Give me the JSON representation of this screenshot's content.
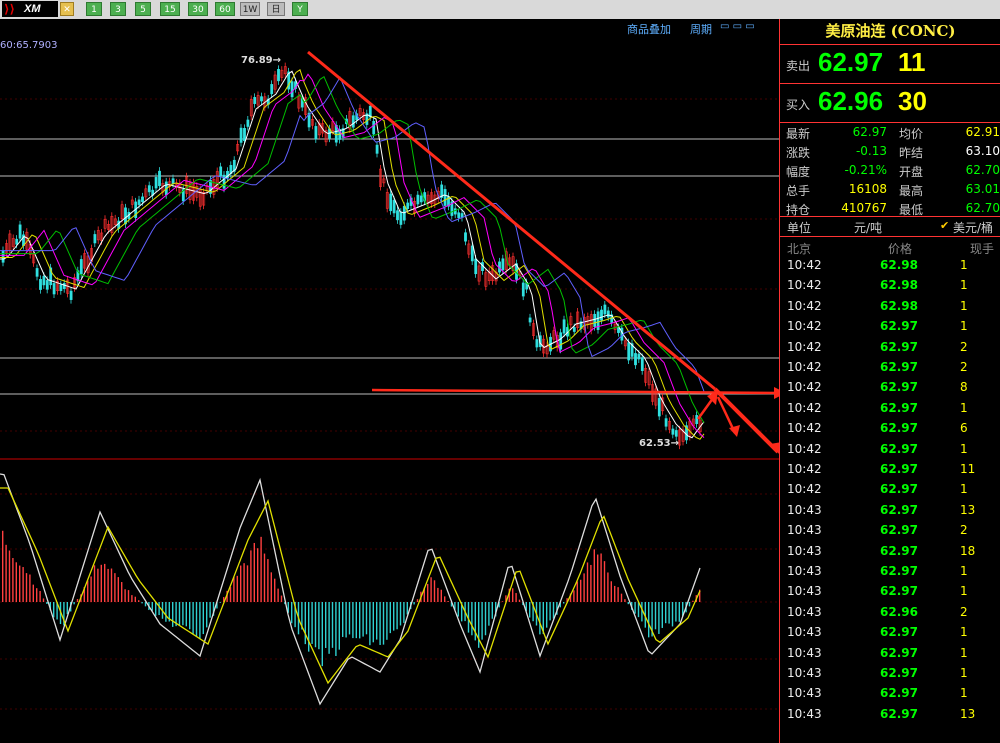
{
  "toolbar": {
    "logo_text": "XM",
    "buttons": [
      "1",
      "3",
      "5",
      "15",
      "30",
      "60",
      "1W",
      "日",
      "Y"
    ]
  },
  "chart": {
    "ma_text": "60:65.7903",
    "menu_overlay": "商品叠加",
    "menu_period": "周期",
    "label_high": "76.89→",
    "label_low": "62.53→"
  },
  "panel": {
    "title": "美原油连 (CONC)",
    "sell_label": "卖出",
    "sell_price": "62.97",
    "sell_vol": "11",
    "buy_label": "买入",
    "buy_price": "62.96",
    "buy_vol": "30",
    "stats_left": [
      {
        "label": "最新",
        "value": "62.97",
        "color": "#00ff00"
      },
      {
        "label": "涨跌",
        "value": "-0.13",
        "color": "#00ff00"
      },
      {
        "label": "幅度",
        "value": "-0.21%",
        "color": "#00ff00"
      },
      {
        "label": "总手",
        "value": "16108",
        "color": "#ffff00"
      },
      {
        "label": "持仓",
        "value": "410767",
        "color": "#ffff00"
      }
    ],
    "stats_right": [
      {
        "label": "均价",
        "value": "62.91",
        "color": "#ffff00"
      },
      {
        "label": "昨结",
        "value": "63.10",
        "color": "#ffffff"
      },
      {
        "label": "开盘",
        "value": "62.70",
        "color": "#00ff00"
      },
      {
        "label": "最高",
        "value": "63.01",
        "color": "#00ff00"
      },
      {
        "label": "最低",
        "value": "62.70",
        "color": "#00ff00"
      }
    ],
    "unit_label": "单位",
    "unit_a": "元/吨",
    "unit_b": "美元/桶",
    "head_time": "北京",
    "head_price": "价格",
    "head_vol": "现手",
    "ticks": [
      {
        "t": "10:42",
        "p": "62.98",
        "v": "1"
      },
      {
        "t": "10:42",
        "p": "62.98",
        "v": "1"
      },
      {
        "t": "10:42",
        "p": "62.98",
        "v": "1"
      },
      {
        "t": "10:42",
        "p": "62.97",
        "v": "1"
      },
      {
        "t": "10:42",
        "p": "62.97",
        "v": "2"
      },
      {
        "t": "10:42",
        "p": "62.97",
        "v": "2"
      },
      {
        "t": "10:42",
        "p": "62.97",
        "v": "8"
      },
      {
        "t": "10:42",
        "p": "62.97",
        "v": "1"
      },
      {
        "t": "10:42",
        "p": "62.97",
        "v": "6"
      },
      {
        "t": "10:42",
        "p": "62.97",
        "v": "1"
      },
      {
        "t": "10:42",
        "p": "62.97",
        "v": "11"
      },
      {
        "t": "10:42",
        "p": "62.97",
        "v": "1"
      },
      {
        "t": "10:43",
        "p": "62.97",
        "v": "13"
      },
      {
        "t": "10:43",
        "p": "62.97",
        "v": "2"
      },
      {
        "t": "10:43",
        "p": "62.97",
        "v": "18"
      },
      {
        "t": "10:43",
        "p": "62.97",
        "v": "1"
      },
      {
        "t": "10:43",
        "p": "62.97",
        "v": "1"
      },
      {
        "t": "10:43",
        "p": "62.96",
        "v": "2"
      },
      {
        "t": "10:43",
        "p": "62.97",
        "v": "1"
      },
      {
        "t": "10:43",
        "p": "62.97",
        "v": "1"
      },
      {
        "t": "10:43",
        "p": "62.97",
        "v": "1"
      },
      {
        "t": "10:43",
        "p": "62.97",
        "v": "1"
      },
      {
        "t": "10:43",
        "p": "62.97",
        "v": "13"
      }
    ]
  }
}
